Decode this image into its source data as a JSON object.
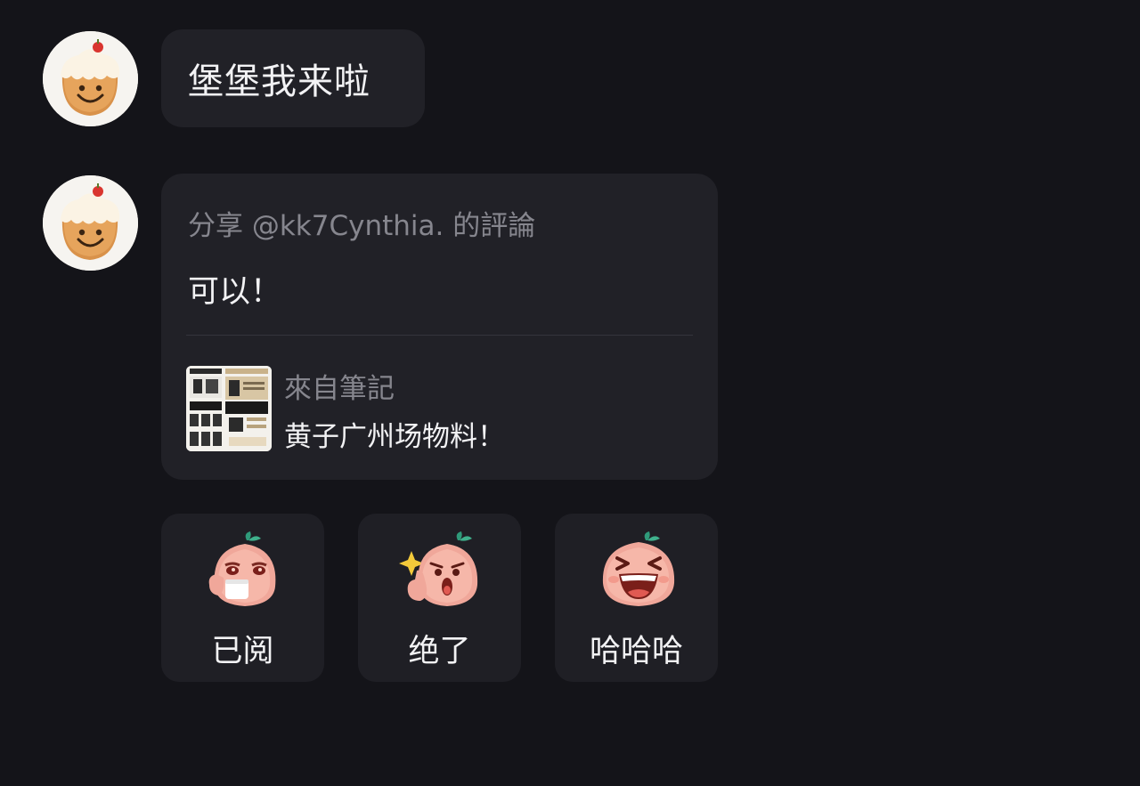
{
  "messages": [
    {
      "text": "堡堡我来啦"
    }
  ],
  "share_card": {
    "header": "分享 @kk7Cynthia. 的評論",
    "body": "可以！",
    "note": {
      "source_label": "來自筆記",
      "title": "黄子广州场物料！"
    }
  },
  "reactions": [
    {
      "label": "已阅",
      "icon": "peach-drinking-tea-sticker"
    },
    {
      "label": "绝了",
      "icon": "peach-thumbs-up-sticker"
    },
    {
      "label": "哈哈哈",
      "icon": "peach-laughing-sticker"
    }
  ],
  "colors": {
    "background": "#141419",
    "bubble": "#212127",
    "muted_text": "#86868e",
    "text": "#f2f2f4"
  }
}
